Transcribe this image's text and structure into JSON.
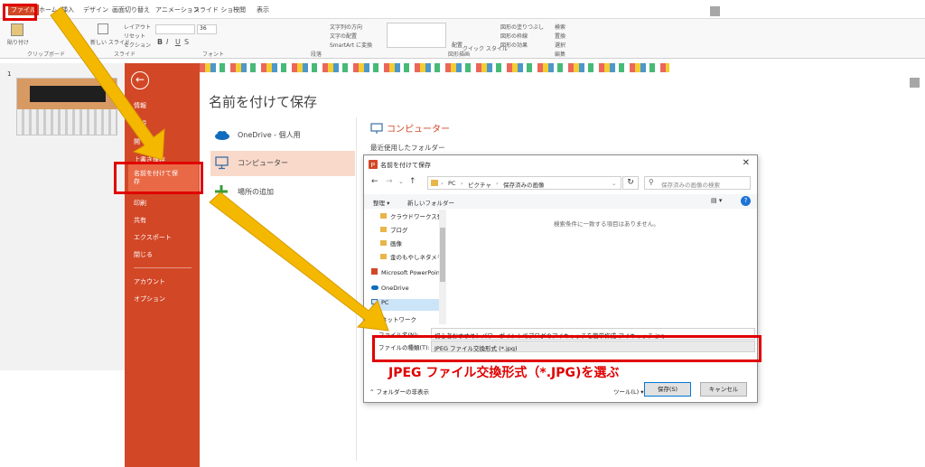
{
  "ribbon": {
    "tabs": [
      "ファイル",
      "ホーム",
      "挿入",
      "デザイン",
      "画面切り替え",
      "アニメーション",
      "スライド ショー",
      "校閲",
      "表示"
    ],
    "groups": [
      "クリップボード",
      "スライド",
      "フォント",
      "段落",
      "図形描画",
      "編集"
    ],
    "paste_label": "貼り付け",
    "new_slide_label": "新しい スライド",
    "layout_label": "レイアウト",
    "reset_label": "リセット",
    "section_label": "セクション",
    "font_size": "36",
    "text_direction": "文字列の方向",
    "align_text": "文字の配置",
    "smartart": "SmartArt に変換",
    "arrange": "配置",
    "quick_styles": "クイック スタイル",
    "shape_fill": "図形の塗りつぶし",
    "shape_outline": "図形の枠線",
    "shape_effects": "図形の効果",
    "find": "検索",
    "replace": "置換",
    "select": "選択"
  },
  "thumbnail": {
    "slide_number": "1"
  },
  "backstage": {
    "nav": [
      "情報",
      "新規",
      "開く",
      "上書き保存",
      "名前を付けて保存",
      "印刷",
      "共有",
      "エクスポート",
      "閉じる",
      "アカウント",
      "オプション"
    ],
    "title": "名前を付けて保存",
    "locations": [
      "OneDrive - 個人用",
      "コンピューター",
      "場所の追加"
    ],
    "computer_heading": "コンピューター",
    "recent_folders": "最近使用したフォルダー"
  },
  "dialog": {
    "title": "名前を付けて保存",
    "breadcrumb": [
      "PC",
      "ピクチャ",
      "保存済みの画像"
    ],
    "search_placeholder": "保存済みの画像の検索",
    "organize": "整理",
    "new_folder": "新しいフォルダー",
    "tree": [
      "クラウドワークス登録",
      "ブログ",
      "画像",
      "金のもやしネタメモ",
      "Microsoft PowerPoint",
      "OneDrive",
      "PC",
      "ネットワーク"
    ],
    "empty_message": "検索条件に一致する項目はありません。",
    "filename_label": "ファイル名(N):",
    "filename_value": "初心者おすすめ！パワーポイントでブログのアイキャッチを簡単作成-アイキャッチ.jpg",
    "filetype_label": "ファイルの種類(T):",
    "filetype_value": "JPEG ファイル交換形式 (*.jpg)",
    "hide_folders": "フォルダーの非表示",
    "tools": "ツール(L)",
    "save": "保存(S)",
    "cancel": "キャンセル"
  },
  "annotation": {
    "text": "JPEG ファイル交換形式（*.JPG)を選ぶ"
  },
  "colors": {
    "backstage": "#d24726",
    "arrow": "#f5b800",
    "highlight_box": "#e00000"
  }
}
